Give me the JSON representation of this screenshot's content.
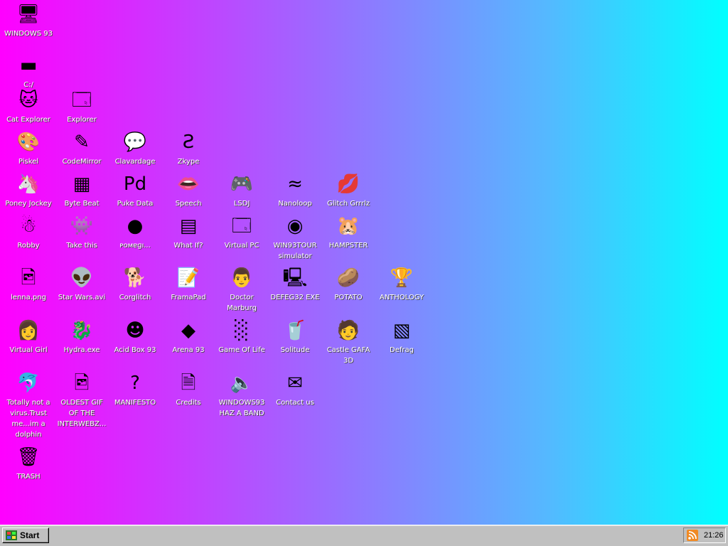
{
  "desktop": {
    "icons": [
      {
        "label": "WINDOWS 93",
        "icon": "computer-icon",
        "glyph": "🖥",
        "col": 0,
        "row": 0
      },
      {
        "label": "C:/",
        "icon": "drive-icon",
        "glyph": "▬",
        "col": 0,
        "row": 1
      },
      {
        "label": "Cat Explorer",
        "icon": "cat-explorer-icon",
        "glyph": "🐱",
        "col": 0,
        "row": 2
      },
      {
        "label": "Explorer",
        "icon": "explorer-icon",
        "glyph": "🗔",
        "col": 1,
        "row": 2
      },
      {
        "label": "Piskel",
        "icon": "palette-icon",
        "glyph": "🎨",
        "col": 0,
        "row": 3
      },
      {
        "label": "CodeMirror",
        "icon": "codemirror-icon",
        "glyph": "✎",
        "col": 1,
        "row": 3
      },
      {
        "label": "Clavardage",
        "icon": "chat-icon",
        "glyph": "💬",
        "col": 2,
        "row": 3
      },
      {
        "label": "Zkype",
        "icon": "zkype-icon",
        "glyph": "Ƨ",
        "col": 3,
        "row": 3
      },
      {
        "label": "Poney Jockey",
        "icon": "pony-icon",
        "glyph": "🦄",
        "col": 0,
        "row": 4
      },
      {
        "label": "Byte Beat",
        "icon": "bytebeat-icon",
        "glyph": "▦",
        "col": 1,
        "row": 4
      },
      {
        "label": "Puke Data",
        "icon": "pd-icon",
        "glyph": "Pd",
        "col": 2,
        "row": 4
      },
      {
        "label": "Speech",
        "icon": "speech-icon",
        "glyph": "👄",
        "col": 3,
        "row": 4
      },
      {
        "label": "LSDJ",
        "icon": "lsdj-icon",
        "glyph": "🎮",
        "col": 4,
        "row": 4
      },
      {
        "label": "Nanoloop",
        "icon": "nanoloop-icon",
        "glyph": "≈",
        "col": 5,
        "row": 4
      },
      {
        "label": "Glitch Grrrlz",
        "icon": "lips-icon",
        "glyph": "💋",
        "col": 6,
        "row": 4
      },
      {
        "label": "Robby",
        "icon": "robby-icon",
        "glyph": "☃",
        "col": 0,
        "row": 5
      },
      {
        "label": "Take this",
        "icon": "take-this-icon",
        "glyph": "👾",
        "col": 1,
        "row": 5
      },
      {
        "label": "ᴘᴏᴍɐɡı...",
        "icon": "potato-small-icon",
        "glyph": "●",
        "col": 2,
        "row": 5
      },
      {
        "label": "What If?",
        "icon": "what-if-icon",
        "glyph": "▤",
        "col": 3,
        "row": 5
      },
      {
        "label": "Virtual PC",
        "icon": "virtual-pc-icon",
        "glyph": "🗔",
        "col": 4,
        "row": 5
      },
      {
        "label": "WIN93TOUR simulator",
        "icon": "tour-icon",
        "glyph": "◉",
        "col": 5,
        "row": 5
      },
      {
        "label": "HAMPSTER",
        "icon": "hampster-icon",
        "glyph": "🐹",
        "col": 6,
        "row": 5
      },
      {
        "label": "lenna.png",
        "icon": "image-file-icon",
        "glyph": "🖻",
        "col": 0,
        "row": 6
      },
      {
        "label": "Star Wars.avi",
        "icon": "yoda-icon",
        "glyph": "👽",
        "col": 1,
        "row": 6
      },
      {
        "label": "Corglitch",
        "icon": "corgi-icon",
        "glyph": "🐕",
        "col": 2,
        "row": 6
      },
      {
        "label": "FramaPad",
        "icon": "framapad-icon",
        "glyph": "📝",
        "col": 3,
        "row": 6
      },
      {
        "label": "Doctor Marburg",
        "icon": "doctor-icon",
        "glyph": "👨",
        "col": 4,
        "row": 6
      },
      {
        "label": "DEFEG32 EXE",
        "icon": "defeg-icon",
        "glyph": "🖳",
        "col": 5,
        "row": 6
      },
      {
        "label": "POTATO",
        "icon": "potato-icon",
        "glyph": "🥔",
        "col": 6,
        "row": 6
      },
      {
        "label": "ANTHOLOGY",
        "icon": "trophy-icon",
        "glyph": "🏆",
        "col": 7,
        "row": 6
      },
      {
        "label": "Virtual Girl",
        "icon": "virtual-girl-icon",
        "glyph": "👩",
        "col": 0,
        "row": 7
      },
      {
        "label": "Hydra.exe",
        "icon": "hydra-icon",
        "glyph": "🐉",
        "col": 1,
        "row": 7
      },
      {
        "label": "Acid Box 93",
        "icon": "smiley-icon",
        "glyph": "☻",
        "col": 2,
        "row": 7
      },
      {
        "label": "Arena 93",
        "icon": "cube-icon",
        "glyph": "◆",
        "col": 3,
        "row": 7
      },
      {
        "label": "Game Of Life",
        "icon": "game-of-life-icon",
        "glyph": "░",
        "col": 4,
        "row": 7
      },
      {
        "label": "Solitude",
        "icon": "solitude-icon",
        "glyph": "🥤",
        "col": 5,
        "row": 7
      },
      {
        "label": "Castle GAFA 3D",
        "icon": "castle-icon",
        "glyph": "🧑",
        "col": 6,
        "row": 7
      },
      {
        "label": "Defrag",
        "icon": "defrag-icon",
        "glyph": "▧",
        "col": 7,
        "row": 7
      },
      {
        "label": "Totally not a virus.Trust me...im a dolphin",
        "icon": "dolphin-icon",
        "glyph": "🐬",
        "col": 0,
        "row": 8
      },
      {
        "label": "OLDEST GIF OF THE INTERWEBZ...",
        "icon": "gif-file-icon",
        "glyph": "🖻",
        "col": 1,
        "row": 8
      },
      {
        "label": "MANIFESTO",
        "icon": "question-icon",
        "glyph": "?",
        "col": 2,
        "row": 8
      },
      {
        "label": "Credits",
        "icon": "document-icon",
        "glyph": "🗎",
        "col": 3,
        "row": 8
      },
      {
        "label": "WINDOWS93 HAZ A BAND",
        "icon": "speaker-icon",
        "glyph": "🔈",
        "col": 4,
        "row": 8
      },
      {
        "label": "Contact us",
        "icon": "contact-icon",
        "glyph": "✉",
        "col": 5,
        "row": 8
      },
      {
        "label": "TRASH",
        "icon": "trash-icon",
        "glyph": "🗑",
        "col": 0,
        "row": 9
      }
    ]
  },
  "colors": {
    "gradient_left": "#ff00ff",
    "gradient_right": "#00ffff",
    "taskbar": "#c0c0c0"
  },
  "taskbar": {
    "start_label": "Start",
    "start_icon": "windows-start-icon",
    "tray_icon": "rss-icon",
    "clock": "21:26"
  }
}
